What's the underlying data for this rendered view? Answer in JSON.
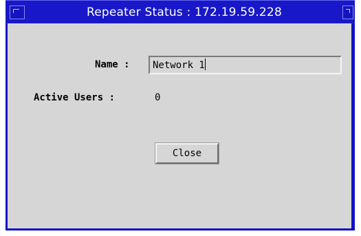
{
  "window": {
    "title": "Repeater Status : 172.19.59.228"
  },
  "form": {
    "name_label": "Name :",
    "name_value": "Network 1",
    "active_users_label": "Active Users :",
    "active_users_value": "0"
  },
  "buttons": {
    "close_label": "Close"
  },
  "icons": {
    "window_menu": "window-menu-icon",
    "window_maximize": "window-maximize-icon"
  },
  "colors": {
    "titlebar": "#1818c8",
    "client_background": "#d6d6d6"
  }
}
